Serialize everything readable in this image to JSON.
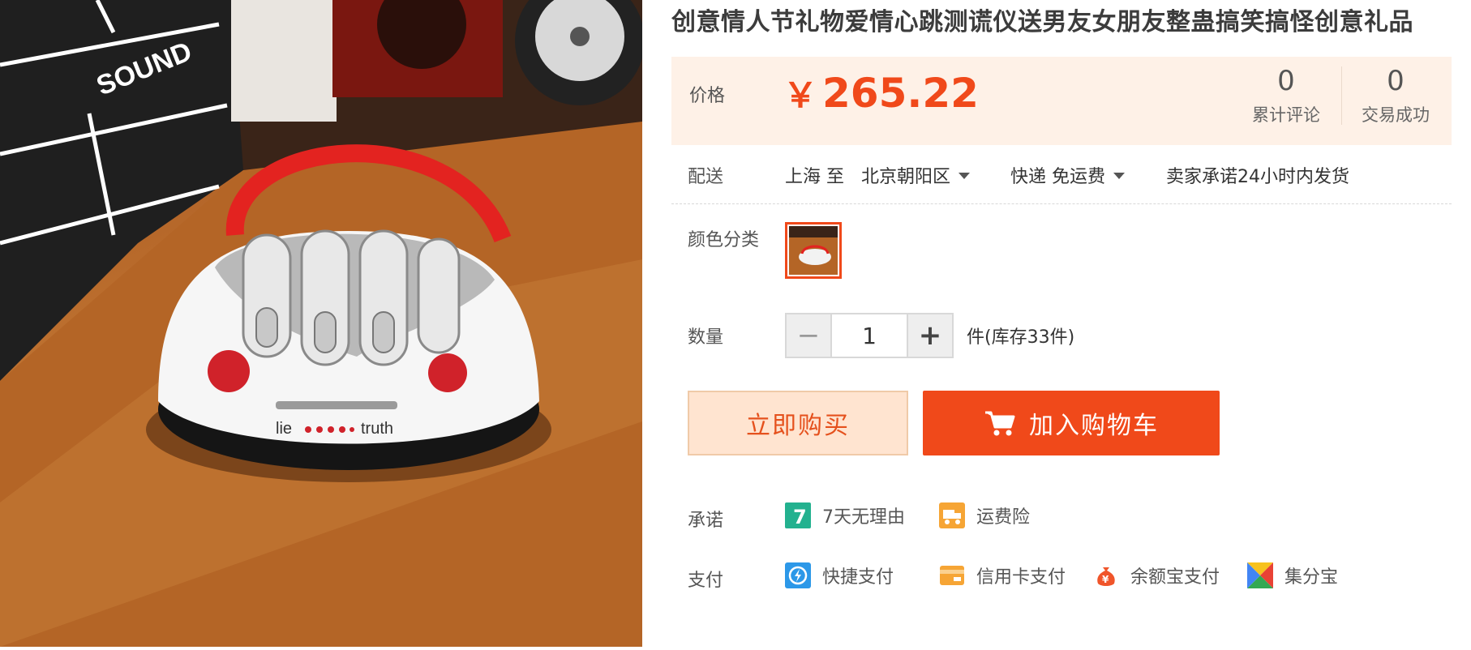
{
  "product": {
    "title": "创意情人节礼物爱情心跳测谎仪送男友女朋友整蛊搞笑搞怪创意礼品",
    "photo_text": {
      "clapper": "SOUND",
      "device_left": "lie",
      "device_right": "truth"
    }
  },
  "price": {
    "label": "价格",
    "currency_symbol": "￥",
    "value": "265.22",
    "color": "#f0491a",
    "stats": [
      {
        "num": "0",
        "label": "累计评论"
      },
      {
        "num": "0",
        "label": "交易成功"
      }
    ]
  },
  "delivery": {
    "label": "配送",
    "from": "上海 至",
    "to": "北京朝阳区",
    "method": "快递 免运费",
    "promise": "卖家承诺24小时内发货"
  },
  "color_option": {
    "label": "颜色分类"
  },
  "quantity": {
    "label": "数量",
    "minus": "−",
    "value": "1",
    "plus": "+",
    "stock": "件(库存33件)"
  },
  "actions": {
    "buy_now": "立即购买",
    "add_cart": "加入购物车"
  },
  "promise": {
    "label": "承诺",
    "items": [
      {
        "icon": "seven-day-return-icon",
        "glyph": "7",
        "text": "7天无理由"
      },
      {
        "icon": "shipping-insurance-icon",
        "text": "运费险"
      }
    ]
  },
  "payment": {
    "label": "支付",
    "items": [
      {
        "icon": "quick-pay-icon",
        "text": "快捷支付"
      },
      {
        "icon": "credit-card-icon",
        "text": "信用卡支付"
      },
      {
        "icon": "yuebao-icon",
        "glyph": "¥",
        "text": "余额宝支付"
      },
      {
        "icon": "jifenbao-icon",
        "text": "集分宝"
      }
    ]
  }
}
